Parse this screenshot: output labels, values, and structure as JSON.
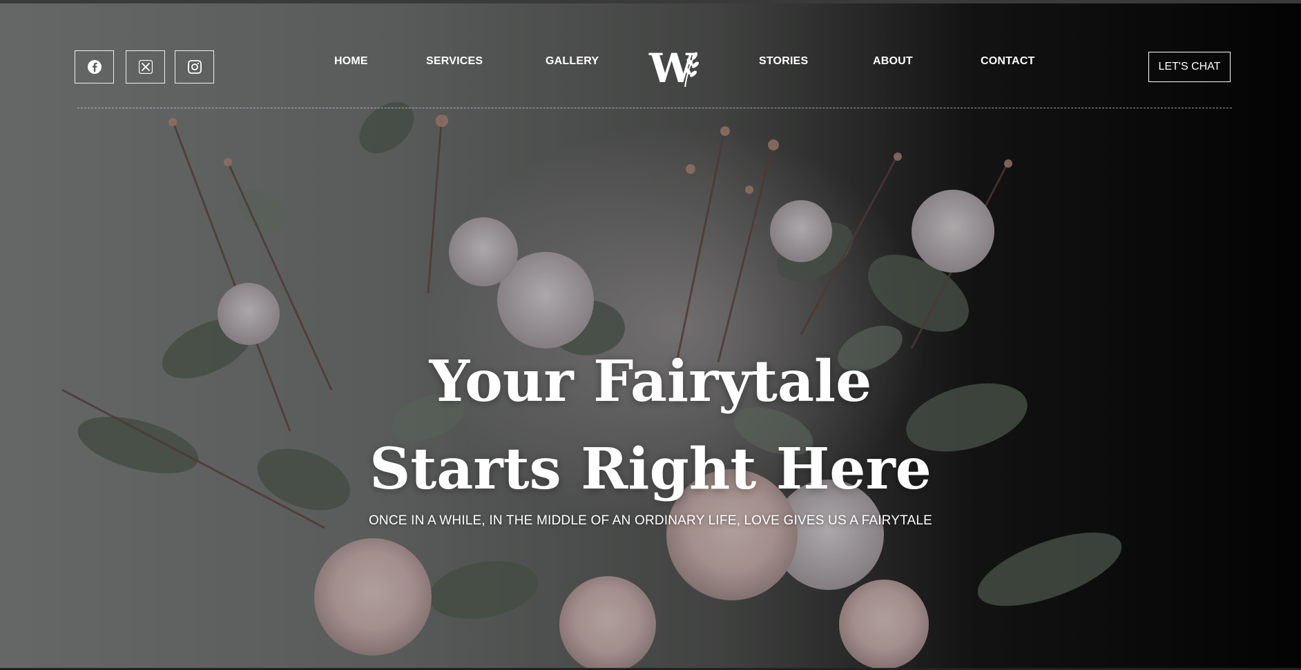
{
  "header": {
    "social": [
      {
        "name": "facebook",
        "icon": "facebook-icon"
      },
      {
        "name": "x",
        "icon": "x-icon"
      },
      {
        "name": "instagram",
        "icon": "instagram-icon"
      }
    ],
    "nav": {
      "home": "HOME",
      "services": "SERVICES",
      "gallery": "GALLERY",
      "stories": "STORIES",
      "about": "ABOUT",
      "contact": "CONTACT"
    },
    "logo_letter": "W",
    "cta_label": "LET'S CHAT"
  },
  "hero": {
    "headline_line1": "Your Fairytale",
    "headline_line2": "Starts Right Here",
    "subline": "ONCE IN A WHILE, IN THE MIDDLE OF AN ORDINARY LIFE, LOVE GIVES US A FAIRYTALE",
    "background": "flower-bouquet-photo"
  },
  "colors": {
    "text": "#ffffff",
    "divider": "#c8cddc",
    "dark_bg": "#050505"
  }
}
